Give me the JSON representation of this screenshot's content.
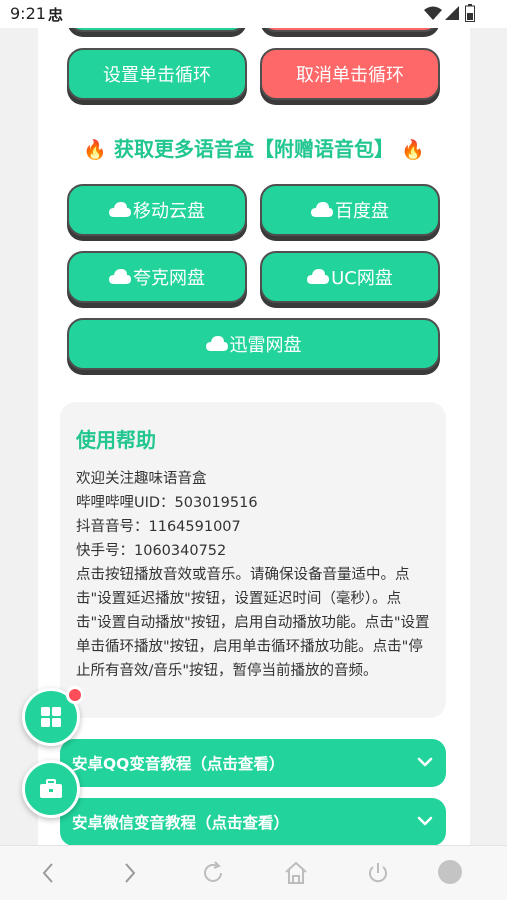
{
  "status_bar": {
    "time": "9:21",
    "notif": "忠"
  },
  "buttons": {
    "set_loop": "设置单击循环",
    "cancel_loop": "取消单击循环"
  },
  "section": {
    "title": "获取更多语音盒【附赠语音包】",
    "fire_left": "🔥",
    "fire_right": "🔥"
  },
  "clouds": [
    {
      "label": "移动云盘"
    },
    {
      "label": "百度盘"
    },
    {
      "label": "夸克网盘"
    },
    {
      "label": "UC网盘"
    },
    {
      "label": "迅雷网盘"
    }
  ],
  "help": {
    "title": "使用帮助",
    "lines": [
      "欢迎关注趣味语音盒",
      "哔哩哔哩UID：503019516",
      "抖音音号：1164591007",
      "快手号：1060340752",
      "点击按钮播放音效或音乐。请确保设备音量适中。点击\"设置延迟播放\"按钮，设置延迟时间（毫秒）。点击\"设置自动播放\"按钮，启用自动播放功能。点击\"设置单击循环播放\"按钮，启用单击循环播放功能。点击\"停止所有音效/音乐\"按钮，暂停当前播放的音频。"
    ]
  },
  "accordions": [
    {
      "label": "安卓QQ变音教程（点击查看）"
    },
    {
      "label": "安卓微信变音教程（点击查看）"
    }
  ],
  "icons": {
    "status": [
      "wifi-icon",
      "signal-icon",
      "battery-icon"
    ],
    "fab": [
      "grid-icon",
      "toolbox-icon"
    ],
    "nav": [
      "back-icon",
      "forward-icon",
      "refresh-icon",
      "home-icon",
      "power-icon",
      "menu-circle-icon"
    ]
  },
  "colors": {
    "primary": "#22d39b",
    "title": "#22c690",
    "danger": "#ff6868",
    "badge": "#ff4d5a"
  }
}
